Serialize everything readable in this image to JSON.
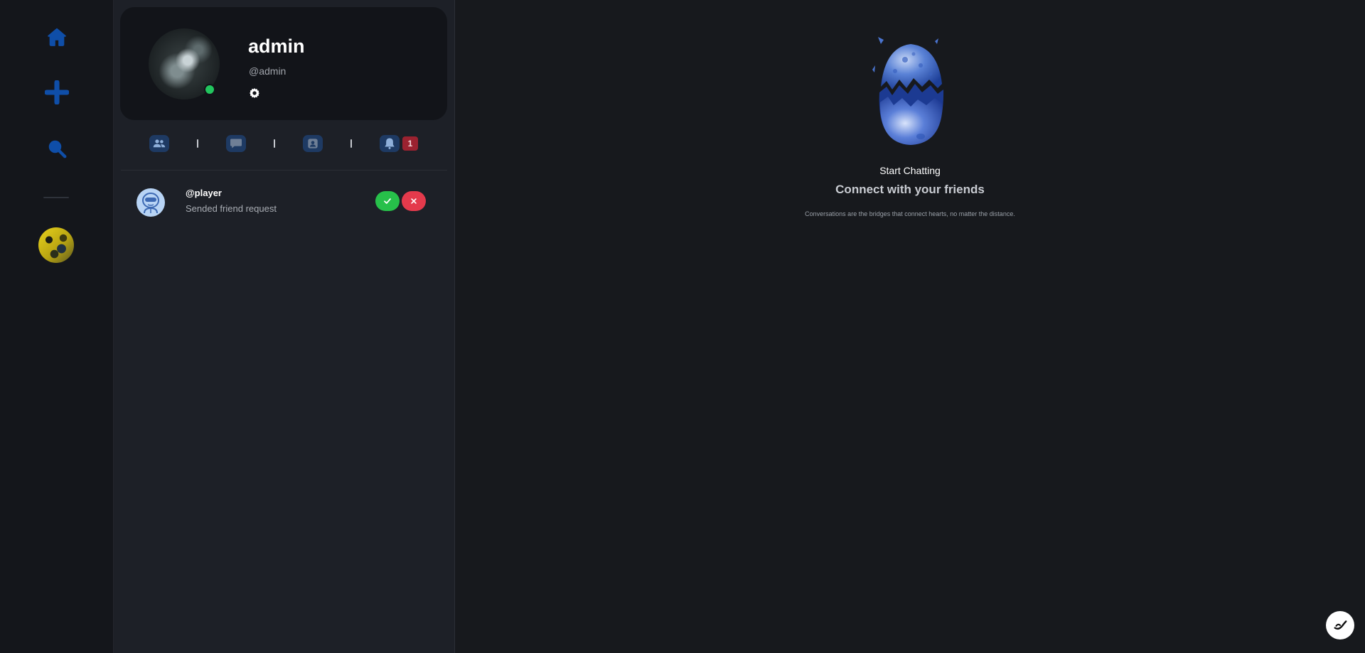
{
  "rail": {
    "items": [
      {
        "name": "home",
        "icon": "home-icon"
      },
      {
        "name": "add",
        "icon": "plus-icon"
      },
      {
        "name": "search",
        "icon": "search-icon"
      }
    ],
    "accent": "#0f4ea8"
  },
  "profile": {
    "name": "admin",
    "handle": "@admin",
    "status": "online"
  },
  "tabs": {
    "items": [
      {
        "icon": "users-icon"
      },
      {
        "icon": "chat-icon"
      },
      {
        "icon": "contact-icon"
      },
      {
        "icon": "bell-icon"
      }
    ],
    "notification_count": "1"
  },
  "requests": [
    {
      "name": "@player",
      "message": "Sended friend request"
    }
  ],
  "main": {
    "title_small": "Start Chatting",
    "title_large": "Connect with your friends",
    "subtitle": "Conversations are the bridges that connect hearts, no matter the distance."
  },
  "colors": {
    "accept": "#27c04a",
    "decline": "#e43a4c",
    "online": "#22c55e",
    "badge": "#9b2230"
  }
}
